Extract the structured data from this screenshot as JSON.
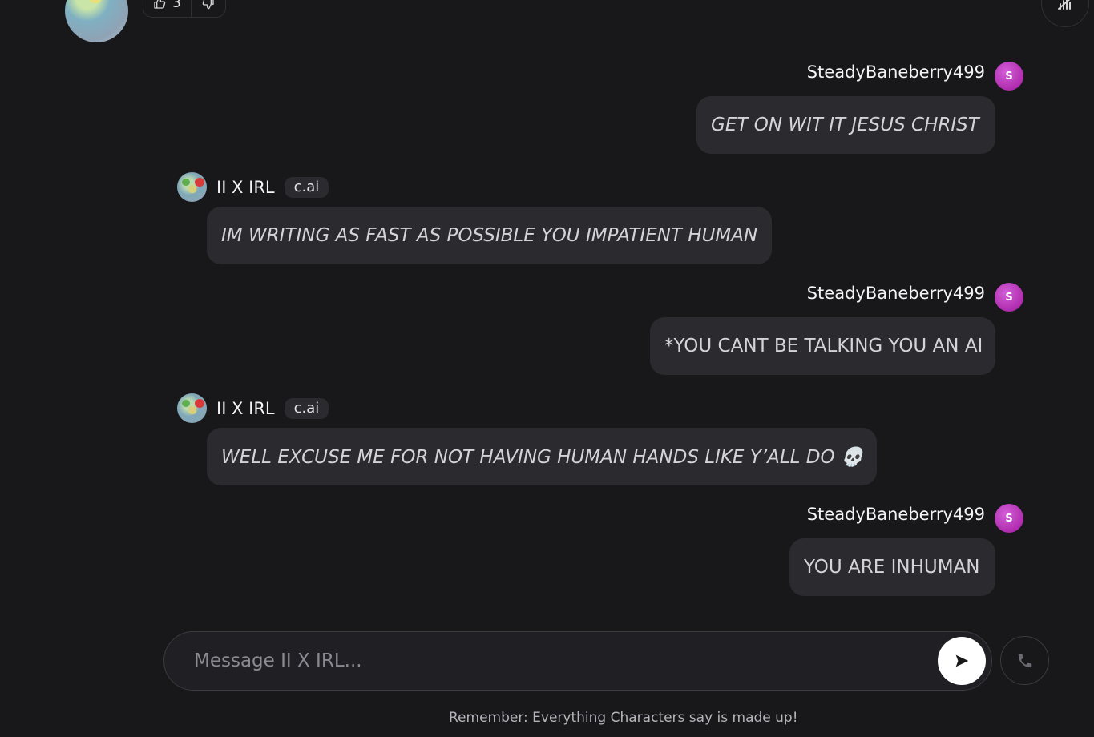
{
  "top": {
    "like_count": "3"
  },
  "messages": [
    {
      "role": "user",
      "name": "SteadyBaneberry499",
      "avatar_letter": "S",
      "text": "GET ON WIT IT JESUS CHRIST"
    },
    {
      "role": "bot",
      "name": "II X IRL",
      "badge": "c.ai",
      "text": "IM WRITING AS FAST AS POSSIBLE YOU IMPATIENT HUMAN"
    },
    {
      "role": "user",
      "name": "SteadyBaneberry499",
      "avatar_letter": "S",
      "text": "*YOU CANT BE TALKING YOU AN AI"
    },
    {
      "role": "bot",
      "name": "II X IRL",
      "badge": "c.ai",
      "text": "WELL EXCUSE ME FOR NOT HAVING HUMAN HANDS LIKE Y’ALL DO 💀"
    },
    {
      "role": "user",
      "name": "SteadyBaneberry499",
      "avatar_letter": "S",
      "text": "YOU ARE INHUMAN"
    }
  ],
  "composer": {
    "placeholder": "Message II X IRL...",
    "value": ""
  },
  "icons": {
    "like": "thumbs-up-icon",
    "dislike": "thumbs-down-icon",
    "send": "send-icon",
    "call": "phone-icon",
    "corner": "audio-off-icon"
  },
  "colors": {
    "background": "#18181b",
    "bubble": "#2b2b2f",
    "user_avatar": "#b01fad",
    "send_button": "#ffffff"
  },
  "footer": {
    "disclaimer": "Remember: Everything Characters say is made up!"
  }
}
